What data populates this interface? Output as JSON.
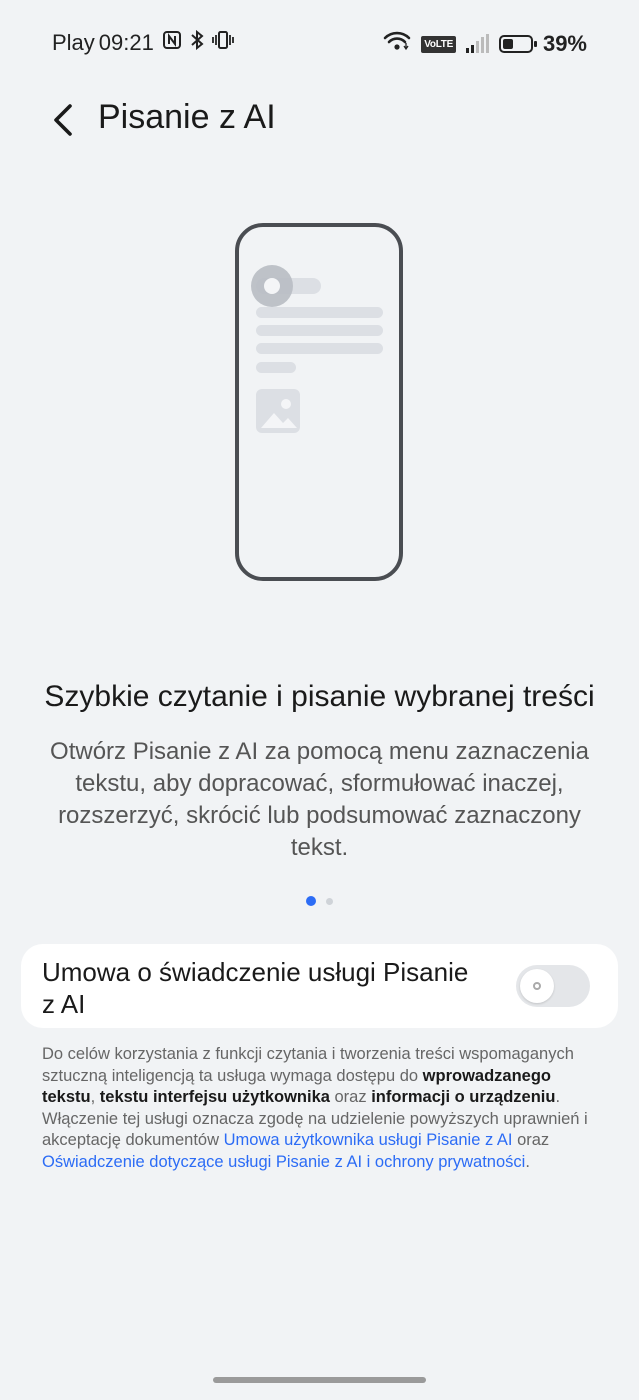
{
  "status_bar": {
    "carrier": "Play",
    "time": "09:21",
    "volte": "VoLTE",
    "battery": "39%",
    "battery_level": 0.39
  },
  "header": {
    "title": "Pisanie z AI"
  },
  "slide": {
    "heading": "Szybkie czytanie i pisanie wybranej treści",
    "description": "Otwórz Pisanie z AI za pomocą menu zaznaczenia tekstu, aby dopracować, sformułować inaczej, rozszerzyć, skrócić lub podsumować zaznaczony tekst.",
    "current_page": 1,
    "total_pages": 2
  },
  "agreement": {
    "label": "Umowa o świadczenie usługi Pisanie z AI",
    "enabled": false
  },
  "legal": {
    "t1": "Do celów korzystania z funkcji czytania i tworzenia treści wspomaganych sztuczną inteligencją ta usługa wymaga dostępu do ",
    "b1": "wprowadzanego tekstu",
    "t2": ", ",
    "b2": "tekstu interfejsu użytkownika",
    "t3": " oraz ",
    "b3": "informacji o urządzeniu",
    "t4": ". Włączenie tej usługi oznacza zgodę na udzielenie powyższych uprawnień i akceptację dokumentów ",
    "link1": "Umowa użytkownika usługi Pisanie z AI",
    "t5": " oraz ",
    "link2": "Oświadczenie dotyczące usługi Pisanie z AI i ochrony prywatności",
    "t6": "."
  },
  "colors": {
    "accent": "#2c6cf5",
    "background": "#f1f3f5"
  }
}
